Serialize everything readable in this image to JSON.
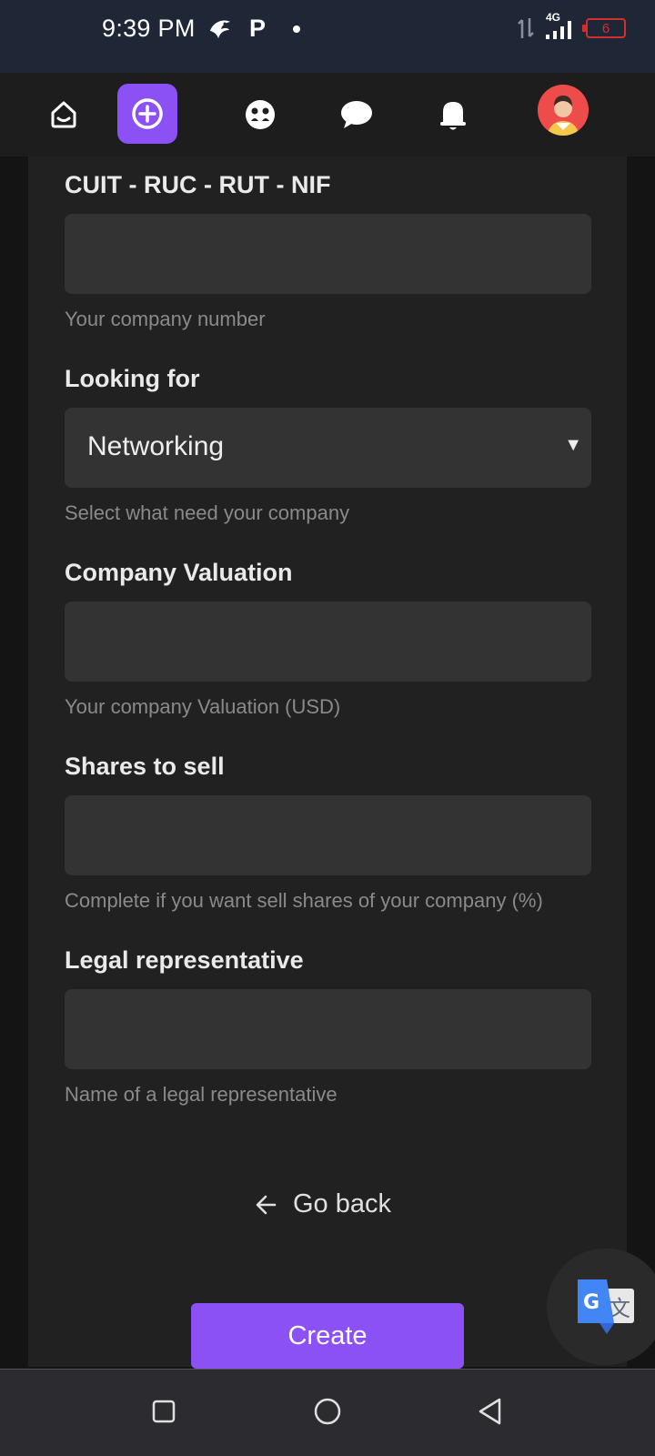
{
  "status_bar": {
    "time": "9:39 PM",
    "network": "4G",
    "battery_level": "6"
  },
  "nav": {
    "items": [
      {
        "icon": "home-icon"
      },
      {
        "icon": "add-circle-icon"
      },
      {
        "icon": "community-icon"
      },
      {
        "icon": "chat-icon"
      },
      {
        "icon": "bell-icon"
      },
      {
        "icon": "avatar"
      }
    ],
    "accent_color": "#8b51f5"
  },
  "form": {
    "fields": [
      {
        "label": "CUIT - RUC - RUT - NIF",
        "value": "",
        "help": "Your company number"
      },
      {
        "label": "Looking for",
        "value": "Networking",
        "help": "Select what need your company"
      },
      {
        "label": "Company Valuation",
        "value": "",
        "help": "Your company Valuation (USD)"
      },
      {
        "label": "Shares to sell",
        "value": "",
        "help": "Complete if you want sell shares of your company (%)"
      },
      {
        "label": "Legal representative",
        "value": "",
        "help": "Name of a legal representative"
      }
    ],
    "go_back": "Go back",
    "create": "Create"
  },
  "system_nav": {
    "buttons": [
      "recents-icon",
      "home-icon",
      "back-icon"
    ]
  }
}
